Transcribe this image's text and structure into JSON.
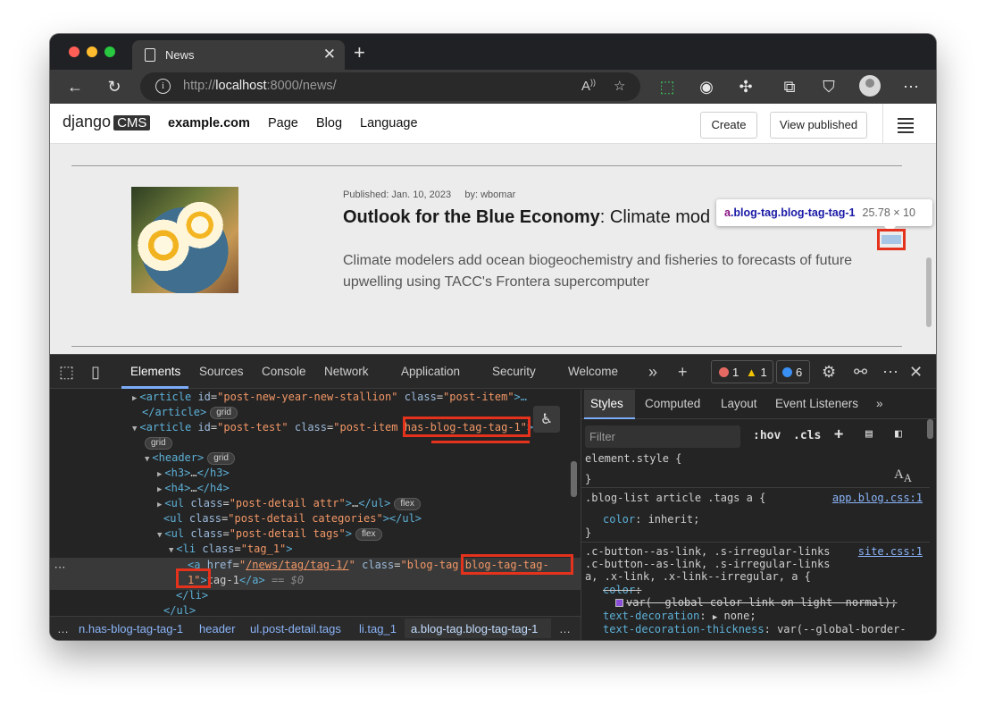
{
  "browser": {
    "tab_title": "News",
    "url_scheme": "http://",
    "url_host": "localhost",
    "url_rest": ":8000/news/"
  },
  "cms": {
    "logo_text": "django",
    "logo_box": "CMS",
    "site": "example.com",
    "nav": [
      "Page",
      "Blog",
      "Language"
    ],
    "create_label": "Create",
    "view_published_label": "View published"
  },
  "post": {
    "published": "Published: Jan. 10, 2023",
    "by": "by: wbomar",
    "title_bold": "Outlook for the Blue Economy",
    "title_rest": ": Climate mod",
    "excerpt": "Climate modelers add ocean biogeochemistry and fisheries to forecasts of future upwelling using TACC's Frontera supercomputer"
  },
  "tooltip": {
    "tag": "a",
    "classes": ".blog-tag.blog-tag-tag-1",
    "size": "25.78 × 10"
  },
  "devtools": {
    "tabs": [
      "Elements",
      "Sources",
      "Console",
      "Network",
      "Application",
      "Security",
      "Welcome"
    ],
    "errors": "1",
    "warnings": "1",
    "info": "6",
    "dom": {
      "l1_id": "post-new-year-new-stallion",
      "l1_class": "post-item",
      "l1_tail": ">…",
      "l3_id": "post-test",
      "l3_class_a": "post-item ",
      "l3_class_b": "has-blog-tag-tag-1",
      "l3_tail": ">",
      "grid": "grid",
      "flex": "flex",
      "ul1_class": "post-detail attr",
      "ul2_class": "post-detail categories",
      "ul3_class": "post-detail tags",
      "li_class": "tag_1",
      "a_href": "/news/tag/tag-1/",
      "a_class_a": "blog-tag ",
      "a_class_b": "blog-tag-tag-",
      "a_class_c": "1",
      "a_text": "tag-1",
      "dollar": " == $0"
    },
    "breadcrumbs": [
      "…",
      "n.has-blog-tag-tag-1",
      "header",
      "ul.post-detail.tags",
      "li.tag_1",
      "a.blog-tag.blog-tag-tag-1",
      "…"
    ],
    "styles": {
      "tabs": [
        "Styles",
        "Computed",
        "Layout",
        "Event Listeners"
      ],
      "filter_placeholder": "Filter",
      "hov": ":hov",
      "cls": ".cls",
      "rule1_selector": "element.style {",
      "rule2_selector": ".blog-list article .tags a {",
      "rule2_source": "app.blog.css:1",
      "rule2_prop": "color",
      "rule2_value": " inherit;",
      "rule3_sel1": ".c-button--as-link, .s-irregular-links",
      "rule3_sel2": ".c-button--as-link, .s-irregular-links",
      "rule3_sel3": "a, .x-link, .x-link--irregular, a {",
      "rule3_source": "site.css:1",
      "p1_name": "color",
      "p1_value": "var(--global-color-link-on-light--normal);",
      "p2_name": "text-decoration",
      "p2_value": " none;",
      "p3_name": "text-decoration-thickness",
      "p3_value": " var(--global-border-"
    }
  }
}
